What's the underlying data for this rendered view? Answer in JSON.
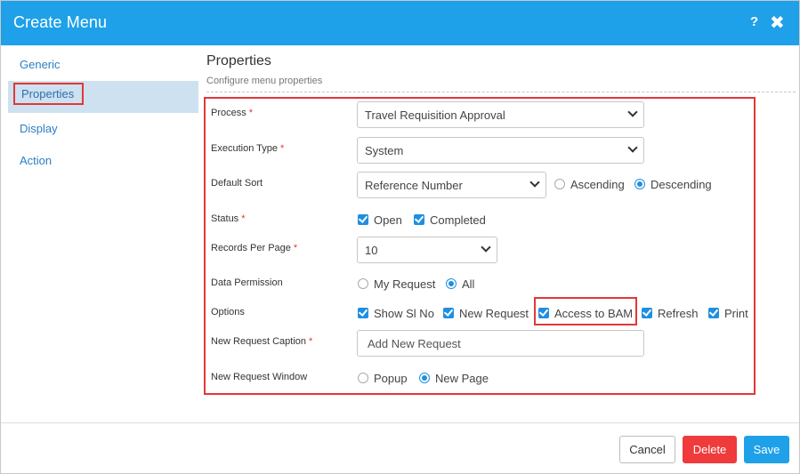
{
  "dialog": {
    "title": "Create Menu",
    "help_label": "?",
    "close_label": "✖"
  },
  "sidebar": {
    "items": [
      {
        "label": "Generic"
      },
      {
        "label": "Properties"
      },
      {
        "label": "Display"
      },
      {
        "label": "Action"
      }
    ],
    "active": "Properties"
  },
  "properties": {
    "title": "Properties",
    "subtitle": "Configure menu properties",
    "required_mark": "*",
    "process": {
      "label": "Process",
      "value": "Travel Requisition Approval"
    },
    "execution_type": {
      "label": "Execution Type",
      "value": "System"
    },
    "default_sort": {
      "label": "Default Sort",
      "value": "Reference Number",
      "ascending": "Ascending",
      "descending": "Descending",
      "selected": "Descending"
    },
    "status": {
      "label": "Status",
      "open": "Open",
      "completed": "Completed"
    },
    "records_per_page": {
      "label": "Records Per Page",
      "value": "10"
    },
    "data_permission": {
      "label": "Data Permission",
      "my_request": "My Request",
      "all": "All",
      "selected": "All"
    },
    "options": {
      "label": "Options",
      "show_sl_no": "Show Sl No",
      "new_request": "New Request",
      "access_to_bam": "Access to BAM",
      "refresh": "Refresh",
      "print": "Print"
    },
    "new_request_caption": {
      "label": "New Request Caption",
      "value": "Add New Request"
    },
    "new_request_window": {
      "label": "New Request Window",
      "popup": "Popup",
      "new_page": "New Page",
      "selected": "New Page"
    }
  },
  "footer": {
    "cancel": "Cancel",
    "delete": "Delete",
    "save": "Save"
  },
  "colors": {
    "accent": "#1ea1e8",
    "danger": "#ef3b3b",
    "highlight_border": "#e03838",
    "active_nav_bg": "#cde1f0"
  }
}
